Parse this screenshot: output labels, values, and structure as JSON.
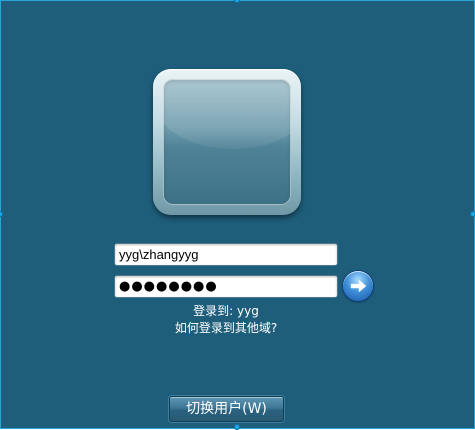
{
  "login": {
    "username": "yyg\\zhangyyg",
    "password_mask": "●●●●●●●●",
    "logon_to": "登录到: yyg",
    "other_domain_link": "如何登录到其他域?",
    "switch_user_label": "切换用户(W)"
  },
  "icons": {
    "submit": "arrow-right-icon",
    "avatar": "user-tile-icon"
  },
  "colors": {
    "background": "#1e5e7b",
    "accent": "#2aa3d6"
  }
}
